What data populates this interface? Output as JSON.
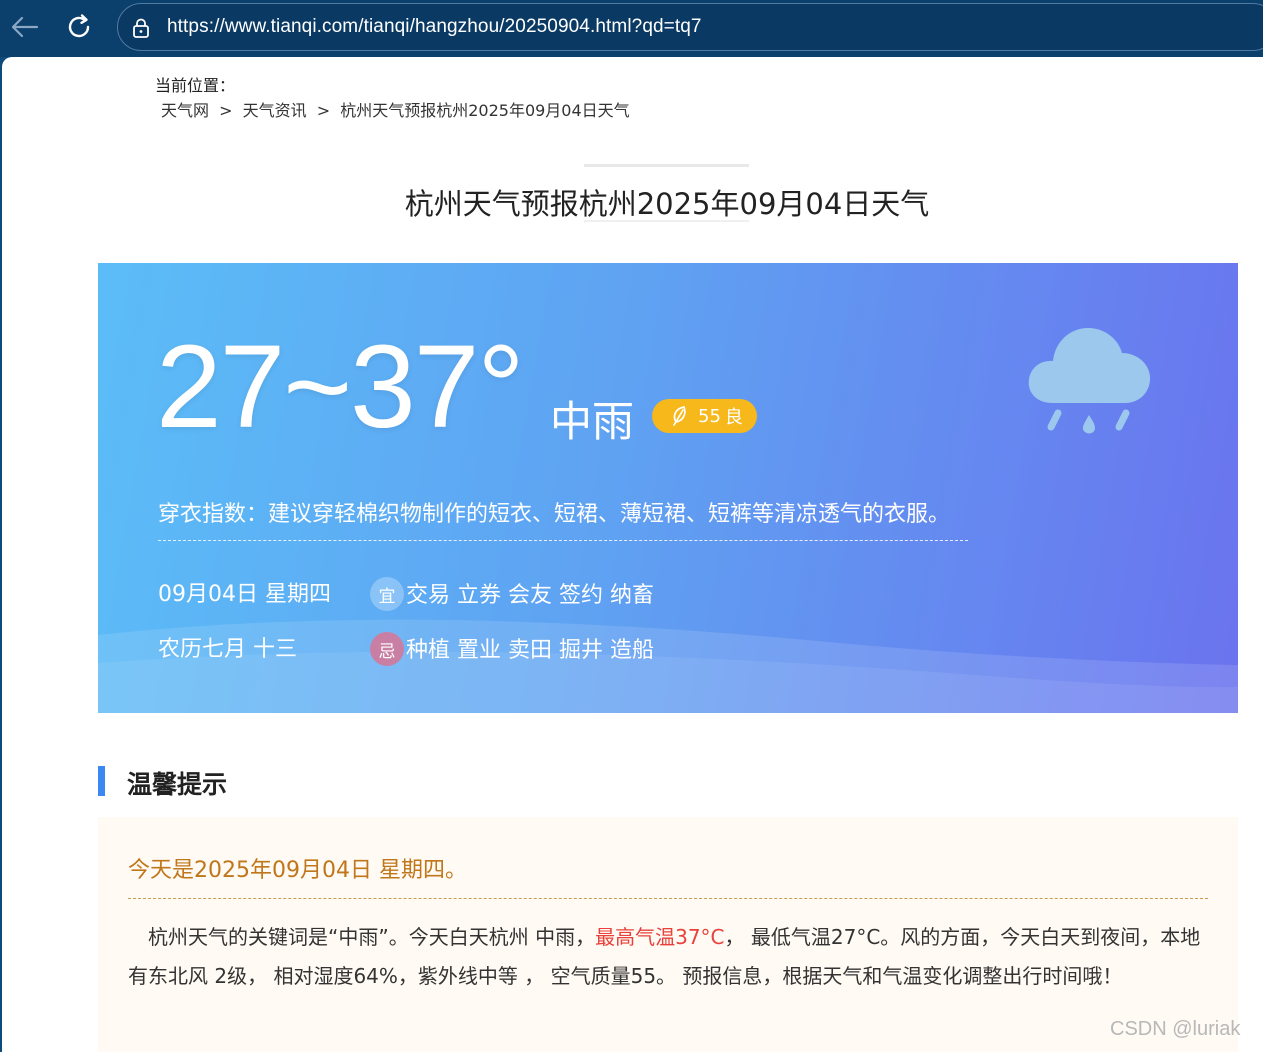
{
  "browser": {
    "url": "https://www.tianqi.com/tianqi/hangzhou/20250904.html?qd=tq7"
  },
  "breadcrumb": {
    "label": "当前位置：",
    "items": [
      "天气网",
      ">",
      "天气资讯",
      ">",
      "杭州天气预报杭州2025年09月04日天气"
    ]
  },
  "page_title": "杭州天气预报杭州2025年09月04日天气",
  "weather": {
    "temperature": "27~37°",
    "condition": "中雨",
    "aqi_value": "55",
    "aqi_level": "良",
    "icon": "rain-cloud-icon",
    "clothing": "穿衣指数：建议穿轻棉织物制作的短衣、短裙、薄短裙、短裤等清凉透气的衣服。",
    "date": "09月04日 星期四",
    "lunar": "农历七月 十三",
    "yi_label": "宜",
    "yi_items": "交易 立券 会友 签约 纳畜",
    "ji_label": "忌",
    "ji_items": "种植 置业 卖田 掘井 造船"
  },
  "tips": {
    "title": "温馨提示",
    "date": "今天是2025年09月04日 星期四。",
    "text_1": "　杭州天气的关键词是“中雨”。今天白天杭州 中雨，",
    "text_highlight": "最高气温37°C",
    "text_2": "，  最低气温27°C。风的方面，今天白天到夜间，本地有东北风 2级，  相对湿度64%，紫外线中等 ，  空气质量55。     预报信息，根据天气和气温变化调整出行时间哦！"
  },
  "watermark": "CSDN @luriak",
  "colors": {
    "accent": "#3b88f3",
    "aqi_badge": "#f6b81a",
    "highlight": "#e8413b",
    "tips_date": "#c0761a"
  }
}
